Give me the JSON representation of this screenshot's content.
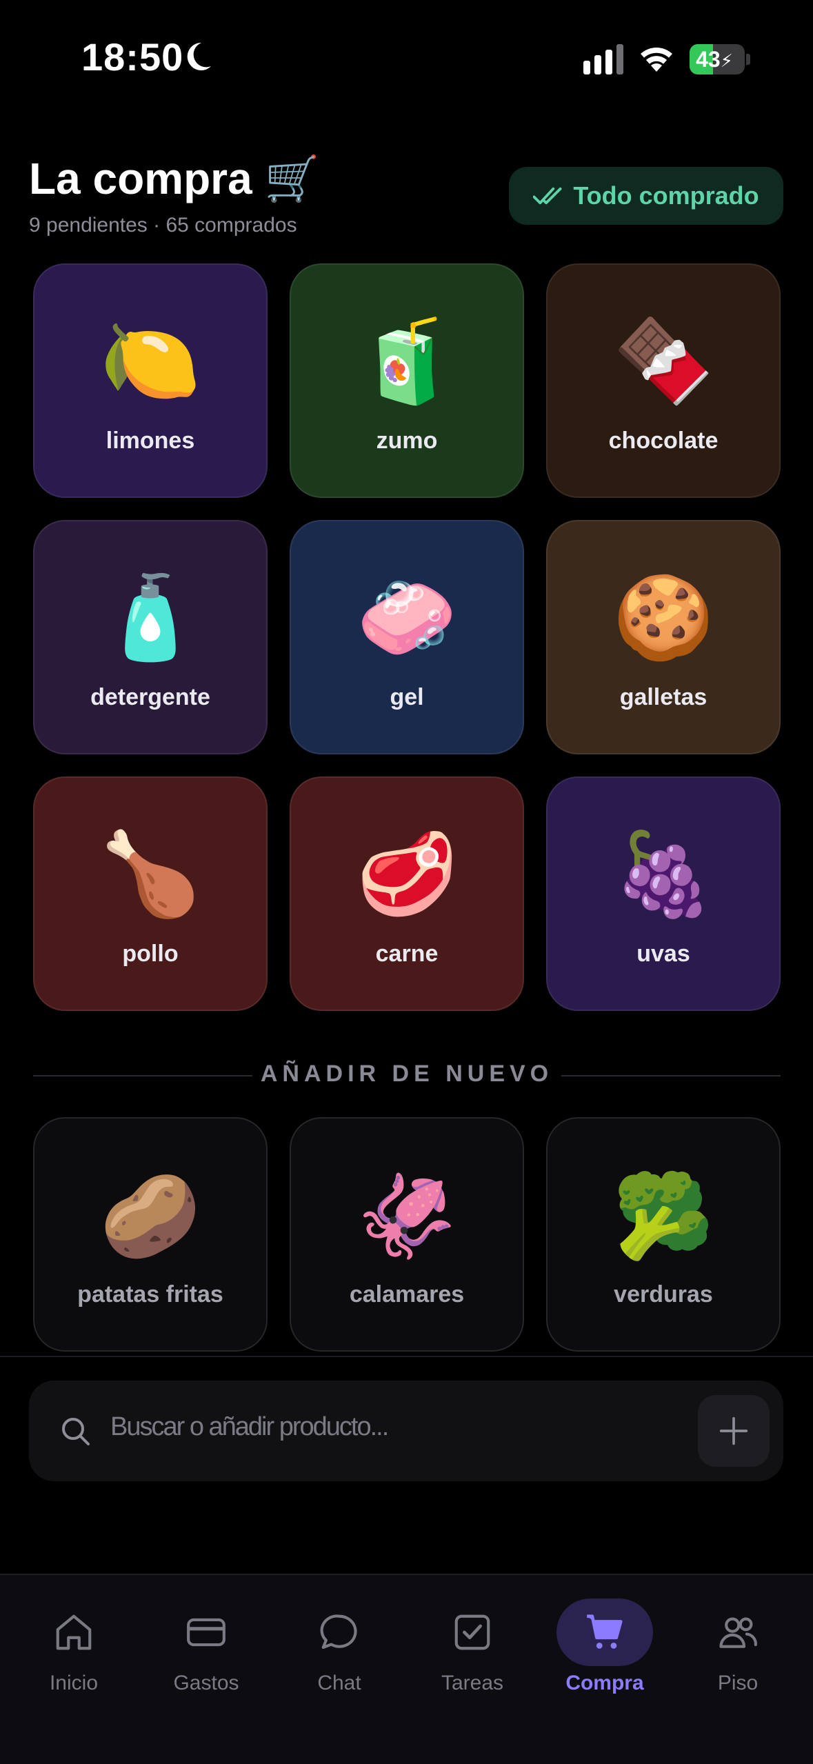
{
  "status_bar": {
    "time": "18:50",
    "battery": "43",
    "battery_level": 0.43
  },
  "header": {
    "title": "La compra 🛒",
    "subtitle": "9 pendientes · 65 comprados",
    "all_bought_label": "Todo comprado"
  },
  "pending": [
    {
      "emoji": "🍋",
      "label": "limones",
      "bg": "#2a1a4d"
    },
    {
      "emoji": "🧃",
      "label": "zumo",
      "bg": "#1b3a1c"
    },
    {
      "emoji": "🍫",
      "label": "chocolate",
      "bg": "#2b1b10"
    },
    {
      "emoji": "🧴",
      "label": "detergente",
      "bg": "#2a1a3a"
    },
    {
      "emoji": "🧼",
      "label": "gel",
      "bg": "#1a2a4d"
    },
    {
      "emoji": "🍪",
      "label": "galletas",
      "bg": "#3b2a1c"
    },
    {
      "emoji": "🍗",
      "label": "pollo",
      "bg": "#4a1a1a"
    },
    {
      "emoji": "🥩",
      "label": "carne",
      "bg": "#4a1a1a"
    },
    {
      "emoji": "🍇",
      "label": "uvas",
      "bg": "#2a1a4d"
    }
  ],
  "re_add": {
    "heading": "AÑADIR DE NUEVO",
    "items": [
      {
        "emoji": "🥔",
        "label": "patatas fritas"
      },
      {
        "emoji": "🦑",
        "label": "calamares"
      },
      {
        "emoji": "🥦",
        "label": "verduras"
      }
    ]
  },
  "search": {
    "placeholder": "Buscar o añadir producto..."
  },
  "tabs": [
    {
      "label": "Inicio",
      "icon": "home-icon"
    },
    {
      "label": "Gastos",
      "icon": "card-icon"
    },
    {
      "label": "Chat",
      "icon": "chat-icon"
    },
    {
      "label": "Tareas",
      "icon": "checkbox-icon"
    },
    {
      "label": "Compra",
      "icon": "cart-icon",
      "active": true
    },
    {
      "label": "Piso",
      "icon": "people-icon"
    }
  ]
}
